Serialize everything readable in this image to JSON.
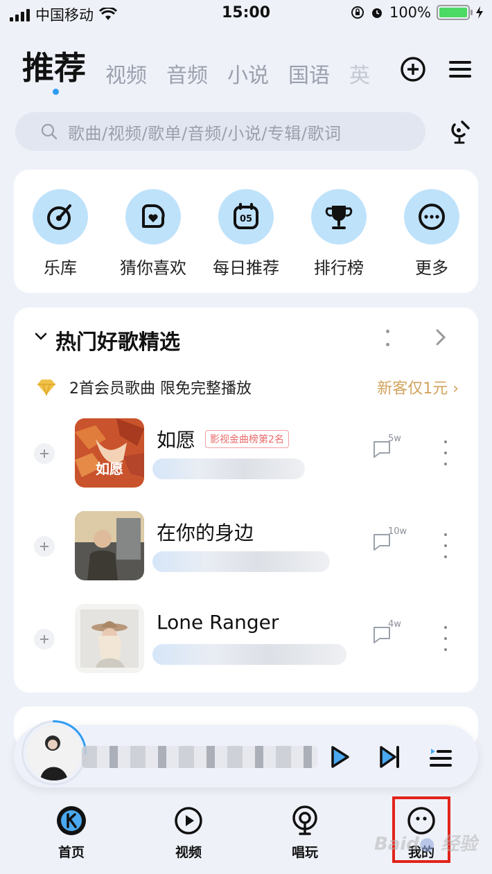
{
  "status_bar": {
    "carrier": "中国移动",
    "time": "15:00",
    "battery": "100%"
  },
  "tabs": [
    "推荐",
    "视频",
    "音频",
    "小说",
    "国语",
    "英"
  ],
  "search": {
    "placeholder": "歌曲/视频/歌单/音频/小说/专辑/歌词"
  },
  "quick_entries": [
    {
      "label": "乐库",
      "icon": "record-icon"
    },
    {
      "label": "猜你喜欢",
      "icon": "heart-music-icon"
    },
    {
      "label": "每日推荐",
      "icon": "calendar-icon",
      "badge": "05"
    },
    {
      "label": "排行榜",
      "icon": "trophy-icon"
    },
    {
      "label": "更多",
      "icon": "more-icon"
    }
  ],
  "section": {
    "title": "热门好歌精选",
    "vip_text": "2首会员歌曲 限免完整播放",
    "vip_link": "新客仅1元"
  },
  "songs": [
    {
      "name": "如愿",
      "tag": "影视金曲榜第2名",
      "comments": "5w"
    },
    {
      "name": "在你的身边",
      "tag": "",
      "comments": "10w"
    },
    {
      "name": "Lone Ranger",
      "tag": "",
      "comments": "4w"
    }
  ],
  "covers": {
    "c1_title": "如愿"
  },
  "bottom_nav": [
    {
      "label": "首页",
      "icon": "home-k-icon"
    },
    {
      "label": "视频",
      "icon": "video-play-icon"
    },
    {
      "label": "唱玩",
      "icon": "mic-icon"
    },
    {
      "label": "我的",
      "icon": "profile-face-icon"
    }
  ],
  "colors": {
    "accent": "#2f9cf2",
    "icon_bg": "#bfe2fb",
    "vip_gold": "#d3a35c",
    "tag_red": "#e96a6a",
    "highlight": "#e2231a"
  }
}
